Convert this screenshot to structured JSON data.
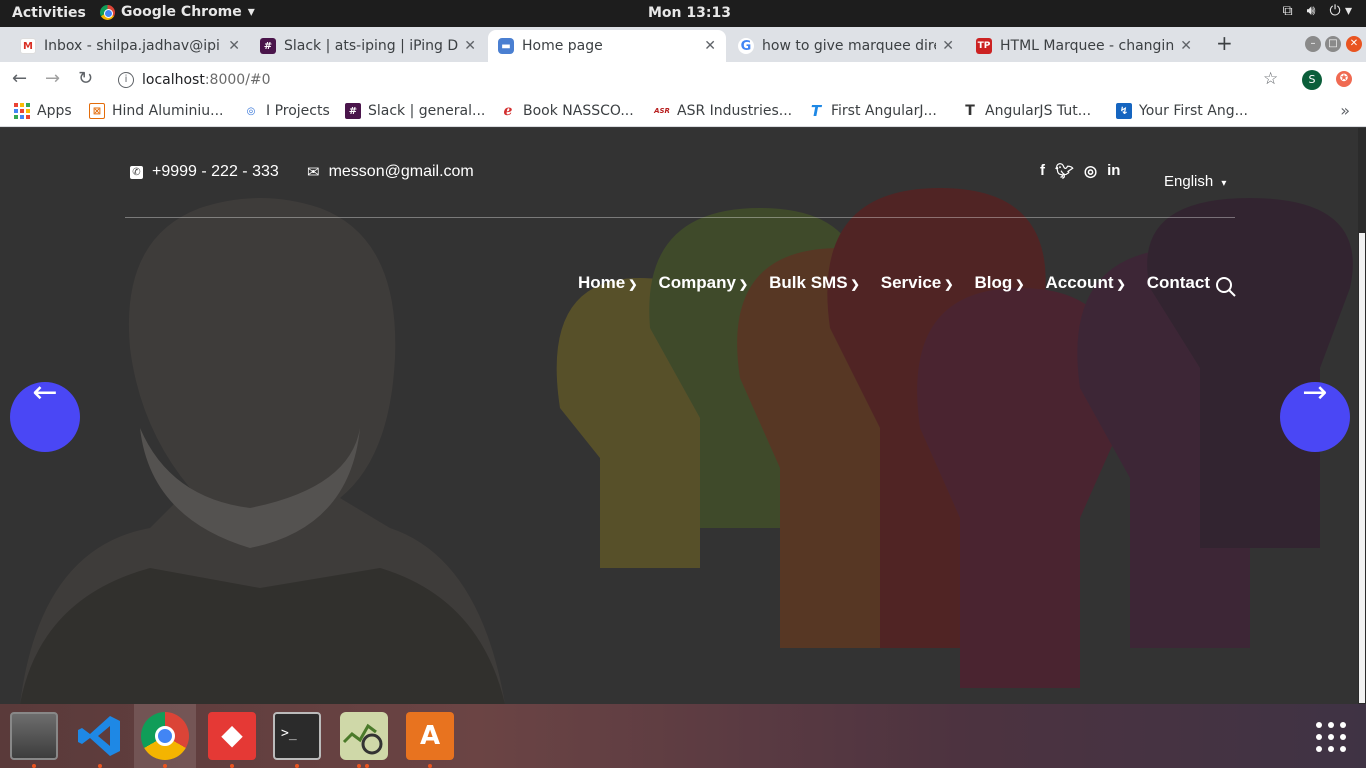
{
  "system_bar": {
    "activities": "Activities",
    "app_name": "Google Chrome",
    "clock": "Mon 13:13"
  },
  "tabs": [
    {
      "title": "Inbox - shilpa.jadhav@ipi",
      "favicon": "gmail-icon",
      "active": false
    },
    {
      "title": "Slack | ats-iping | iPing Da",
      "favicon": "slack-icon",
      "active": false
    },
    {
      "title": "Home page",
      "favicon": "chat-icon",
      "active": true
    },
    {
      "title": "how to give marquee dire",
      "favicon": "google-icon",
      "active": false
    },
    {
      "title": "HTML Marquee - changing",
      "favicon": "site-icon",
      "active": false
    }
  ],
  "address_bar": {
    "host": "localhost",
    "path": ":8000/#0",
    "profile_initial": "S"
  },
  "bookmarks": [
    {
      "label": "Apps"
    },
    {
      "label": "Hind Aluminiu..."
    },
    {
      "label": "I Projects"
    },
    {
      "label": "Slack | general..."
    },
    {
      "label": "Book NASSCO..."
    },
    {
      "label": "ASR Industries..."
    },
    {
      "label": "First AngularJ..."
    },
    {
      "label": "AngularJS Tut..."
    },
    {
      "label": "Your First Ang..."
    }
  ],
  "page": {
    "phone": "+9999 - 222 - 333",
    "email": "messon@gmail.com",
    "social": [
      "facebook-icon",
      "twitter-icon",
      "instagram-icon",
      "linkedin-icon"
    ],
    "language": "English",
    "menu": [
      {
        "label": "Home",
        "has_dropdown": true
      },
      {
        "label": "Company",
        "has_dropdown": true
      },
      {
        "label": "Bulk SMS",
        "has_dropdown": true
      },
      {
        "label": "Service",
        "has_dropdown": true
      },
      {
        "label": "Blog",
        "has_dropdown": true
      },
      {
        "label": "Account",
        "has_dropdown": true
      },
      {
        "label": "Contact",
        "has_dropdown": false
      }
    ]
  },
  "dock": [
    "files-icon",
    "vscode-icon",
    "chrome-icon",
    "anydesk-icon",
    "terminal-icon",
    "system-monitor-icon",
    "software-center-icon"
  ],
  "colors": {
    "slider_arrow": "#4a47f5",
    "accent": "#e95420"
  }
}
